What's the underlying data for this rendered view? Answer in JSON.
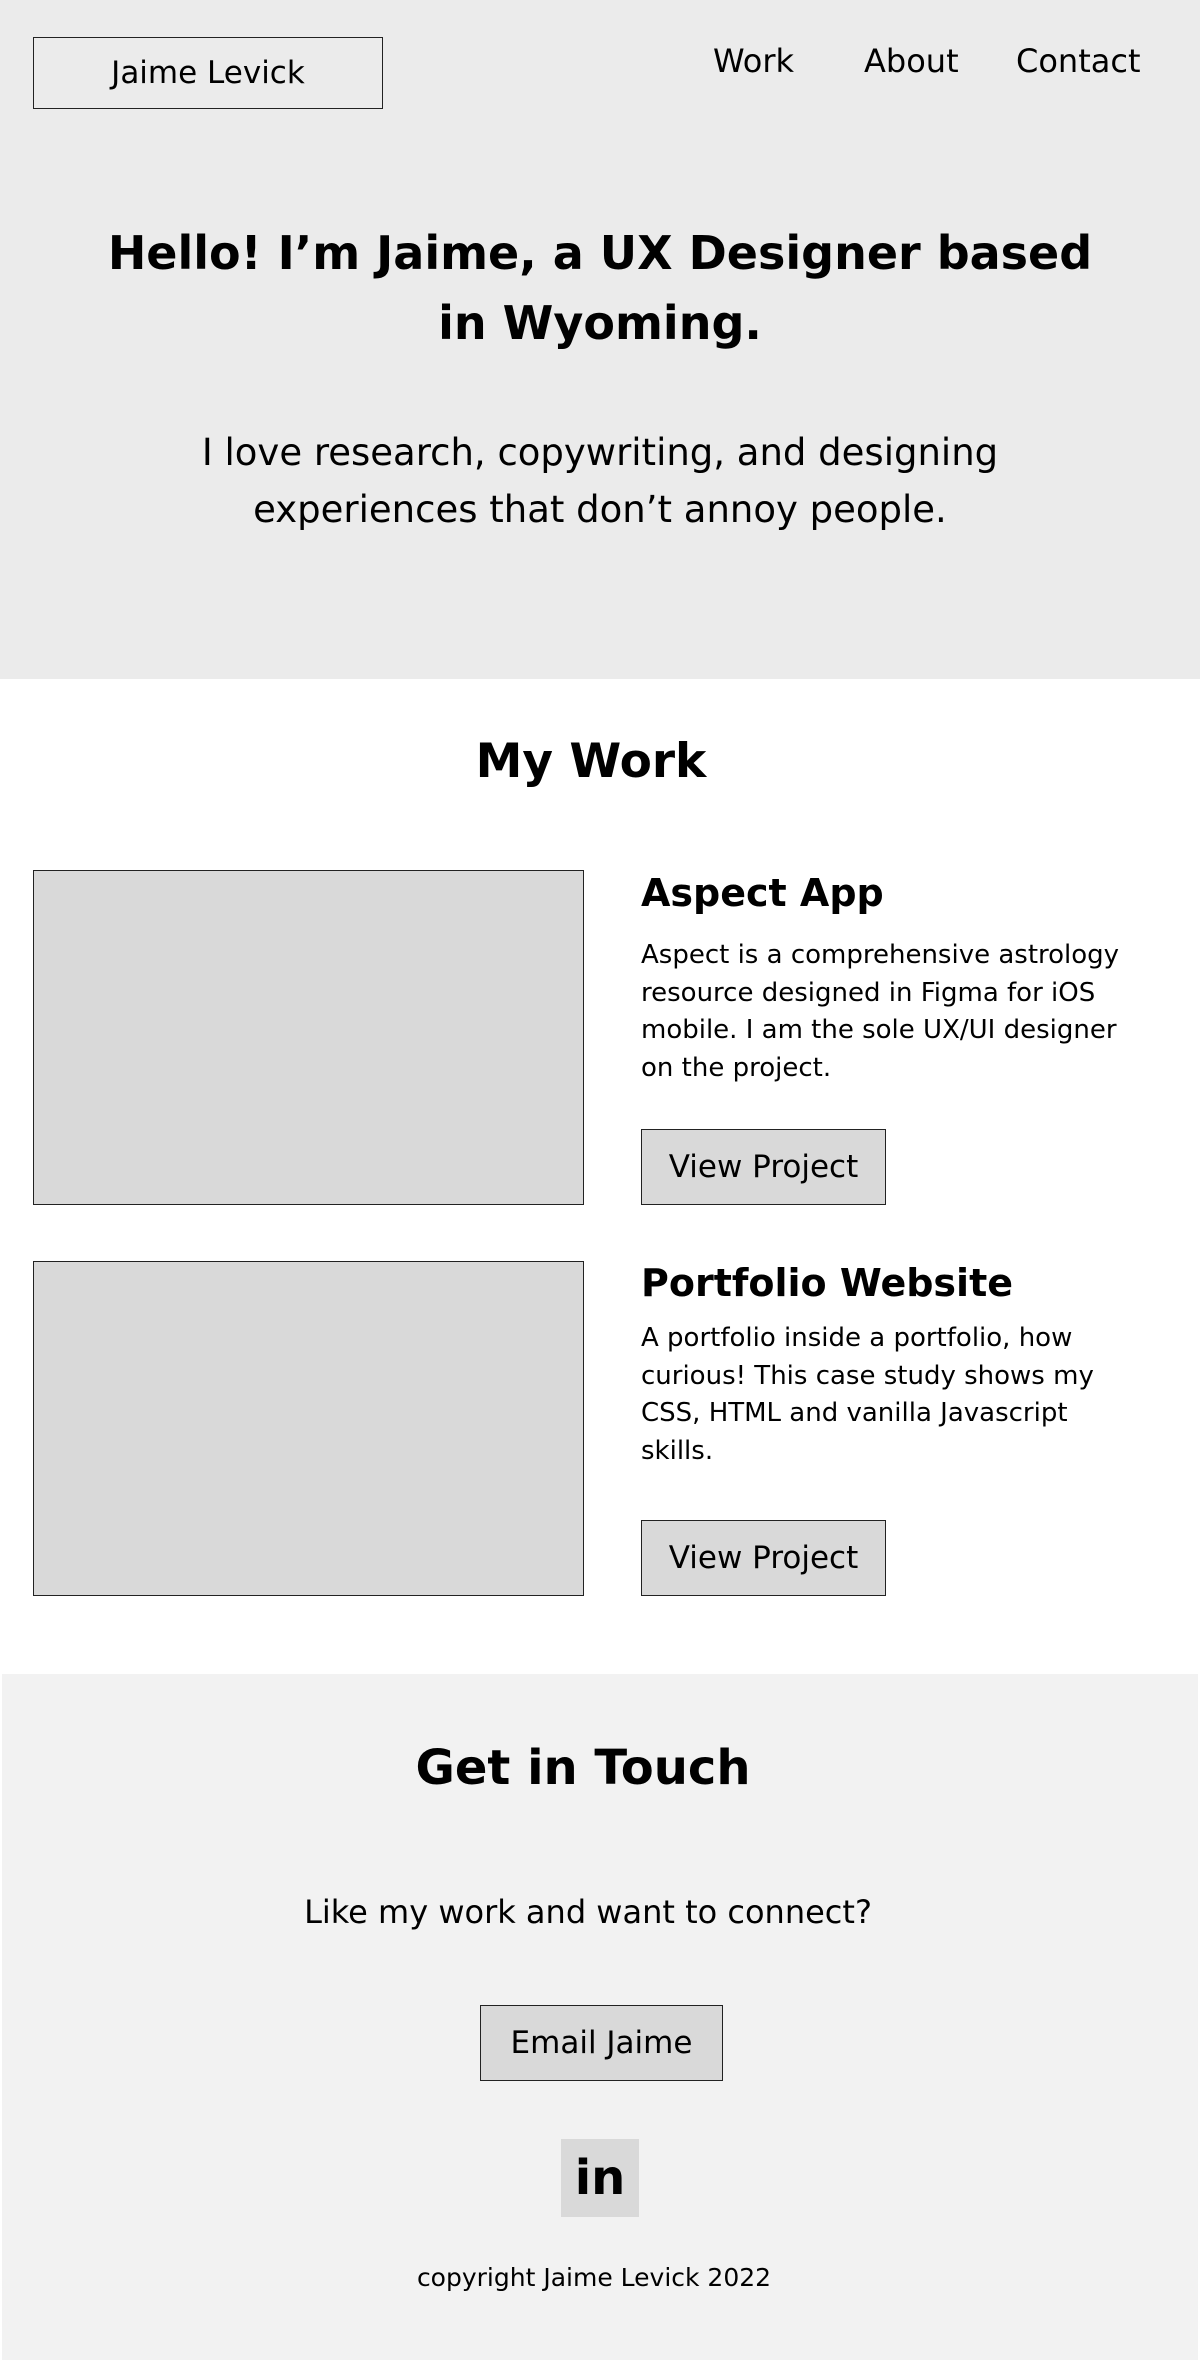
{
  "header": {
    "logo_text": "Jaime Levick",
    "nav": [
      {
        "label": "Work"
      },
      {
        "label": "About"
      },
      {
        "label": "Contact"
      }
    ]
  },
  "hero": {
    "title_line1": "Hello! I’m Jaime, a UX Designer based",
    "title_line2": "in Wyoming.",
    "subtitle_line1": "I love research, copywriting, and designing",
    "subtitle_line2": "experiences that don’t annoy people."
  },
  "work": {
    "heading": "My Work",
    "projects": [
      {
        "title": "Aspect App",
        "description": "Aspect is a comprehensive astrology resource designed in Figma for iOS mobile. I am the sole UX/UI designer on the project.",
        "button_label": "View Project"
      },
      {
        "title": "Portfolio Website",
        "description": "A portfolio inside a portfolio, how curious! This case study shows my CSS, HTML and vanilla Javascript skills.",
        "button_label": "View Project"
      }
    ]
  },
  "contact": {
    "heading": "Get in Touch",
    "subtitle": "Like my work and want to connect?",
    "email_button_label": "Email Jaime",
    "linkedin_icon_text": "in",
    "copyright": "copyright Jaime Levick 2022"
  },
  "colors": {
    "hero_bg": "#ebebeb",
    "contact_bg": "#f2f2f2",
    "placeholder_gray": "#d9d9d9",
    "text": "#000000"
  }
}
